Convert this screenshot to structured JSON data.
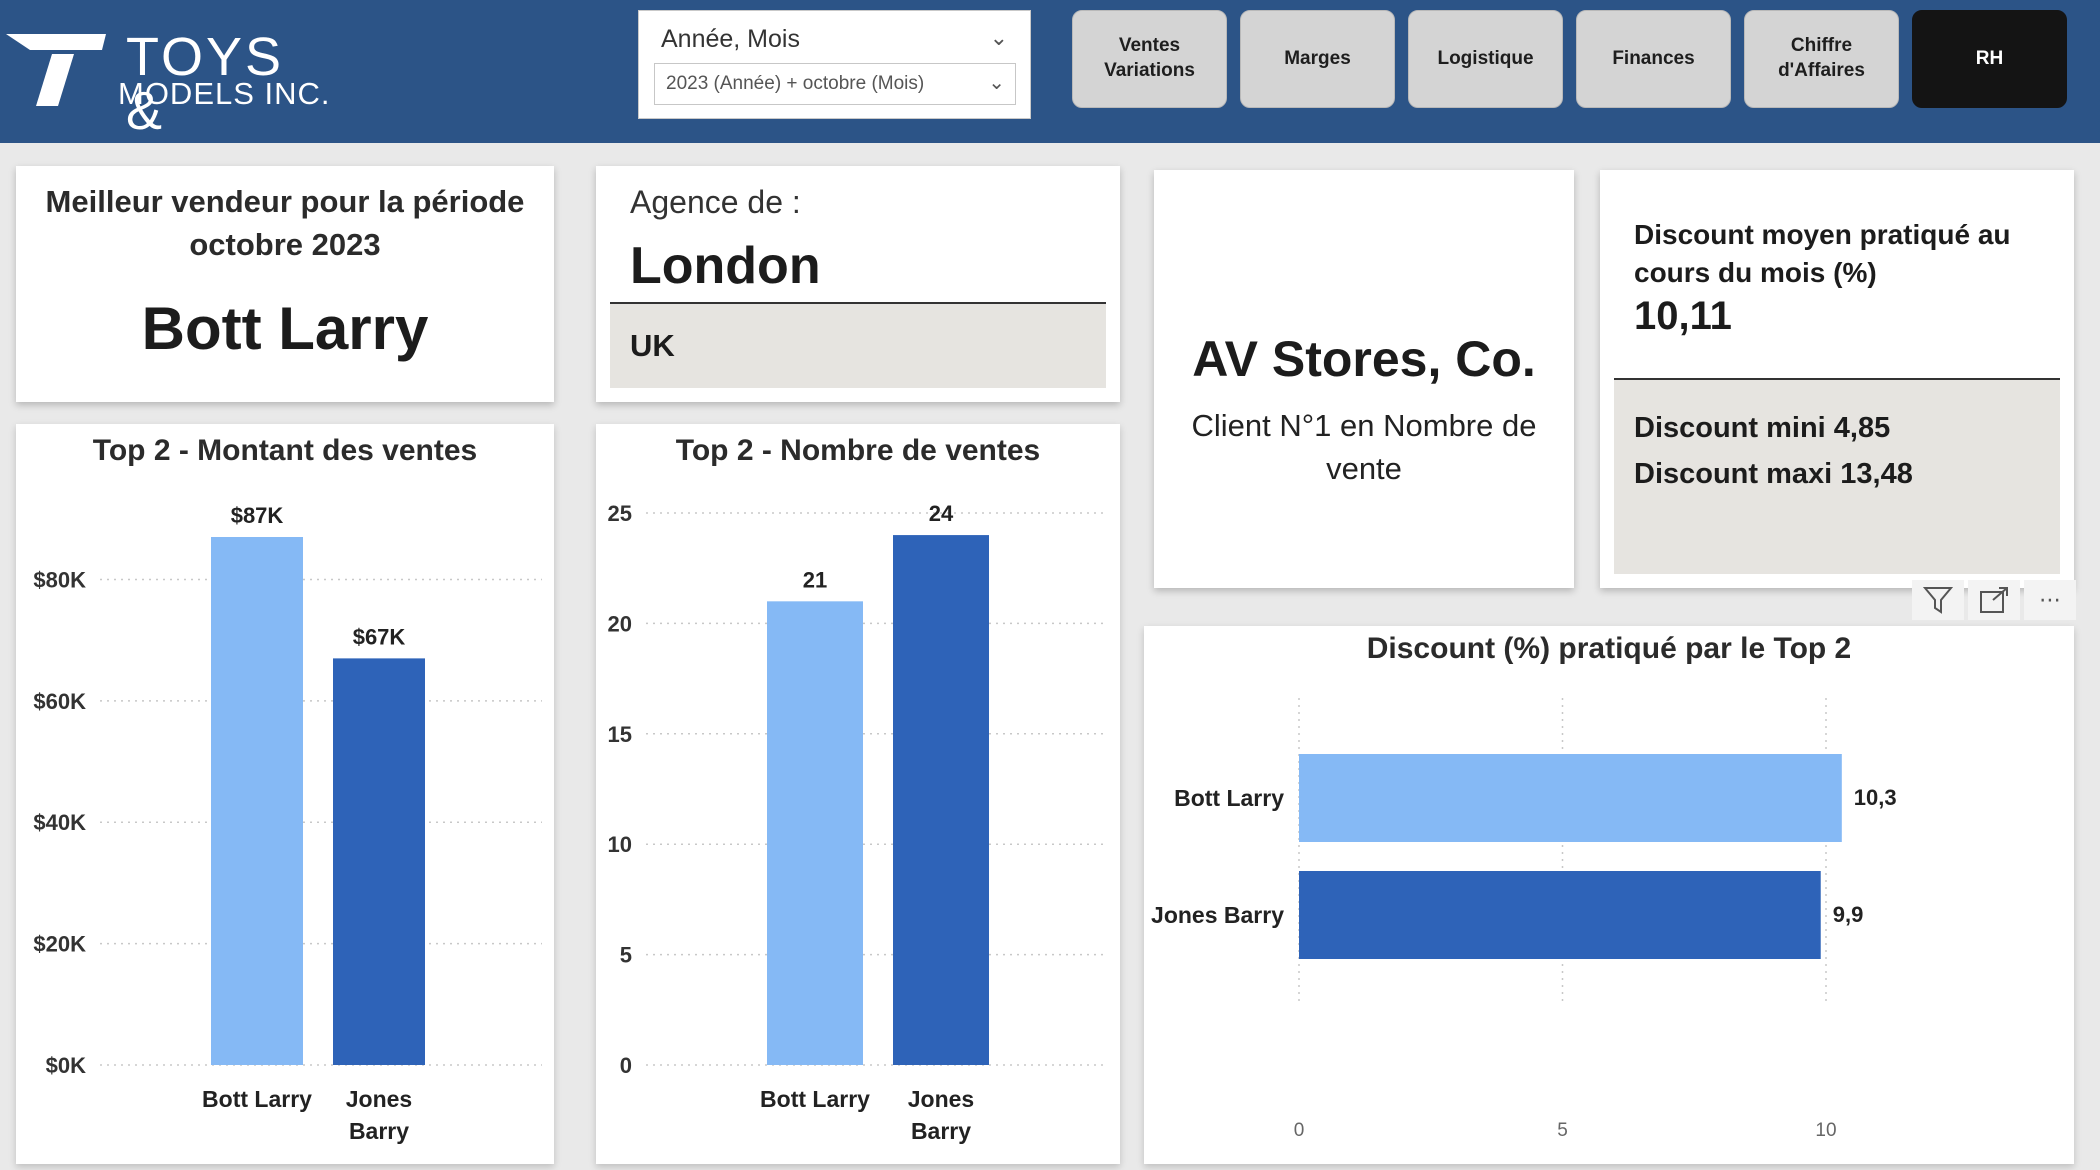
{
  "header": {
    "logo": {
      "line1": "TOYS &",
      "line2": "MODELS INC."
    },
    "slicer": {
      "title": "Année, Mois",
      "value": "2023 (Année) + octobre (Mois)"
    },
    "nav": [
      {
        "label": "Ventes Variations",
        "active": false
      },
      {
        "label": "Marges",
        "active": false
      },
      {
        "label": "Logistique",
        "active": false
      },
      {
        "label": "Finances",
        "active": false
      },
      {
        "label": "Chiffre d'Affaires",
        "active": false
      },
      {
        "label": "RH",
        "active": true
      }
    ]
  },
  "best_seller": {
    "title_line1": "Meilleur vendeur pour la période",
    "title_line2": "octobre 2023",
    "name": "Bott Larry"
  },
  "agency": {
    "label": "Agence de :",
    "city": "London",
    "country": "UK"
  },
  "top_client": {
    "name": "AV Stores, Co.",
    "subtitle": "Client N°1 en Nombre de vente"
  },
  "discount": {
    "title": "Discount moyen pratiqué au cours du mois (%)",
    "value": "10,11",
    "min_label": "Discount mini 4,85",
    "max_label": "Discount maxi 13,48"
  },
  "colors": {
    "light_blue": "#85b9f5",
    "dark_blue": "#2e63b8",
    "header": "#2c5487"
  },
  "chart_data": [
    {
      "type": "bar",
      "title": "Top 2 - Montant des ventes",
      "categories": [
        "Bott Larry",
        "Jones Barry"
      ],
      "values": [
        87,
        67
      ],
      "data_labels": [
        "$87K",
        "$67K"
      ],
      "y_ticks": [
        "$0K",
        "$20K",
        "$40K",
        "$60K",
        "$80K"
      ],
      "y_tick_values": [
        0,
        20,
        40,
        60,
        80
      ],
      "ylim": [
        0,
        87
      ],
      "grid": true
    },
    {
      "type": "bar",
      "title": "Top 2 - Nombre de ventes",
      "categories": [
        "Bott Larry",
        "Jones Barry"
      ],
      "values": [
        21,
        24
      ],
      "data_labels": [
        "21",
        "24"
      ],
      "y_ticks": [
        "0",
        "5",
        "10",
        "15",
        "20",
        "25"
      ],
      "y_tick_values": [
        0,
        5,
        10,
        15,
        20,
        25
      ],
      "ylim": [
        0,
        25
      ],
      "grid": true
    },
    {
      "type": "bar",
      "orientation": "horizontal",
      "title": "Discount (%) pratiqué par le Top 2",
      "categories": [
        "Bott Larry",
        "Jones Barry"
      ],
      "values": [
        10.3,
        9.9
      ],
      "data_labels": [
        "10,3",
        "9,9"
      ],
      "x_ticks": [
        "0",
        "5",
        "10"
      ],
      "x_tick_values": [
        0,
        5,
        10
      ],
      "xlim": [
        0,
        10.3
      ],
      "grid": true
    }
  ]
}
